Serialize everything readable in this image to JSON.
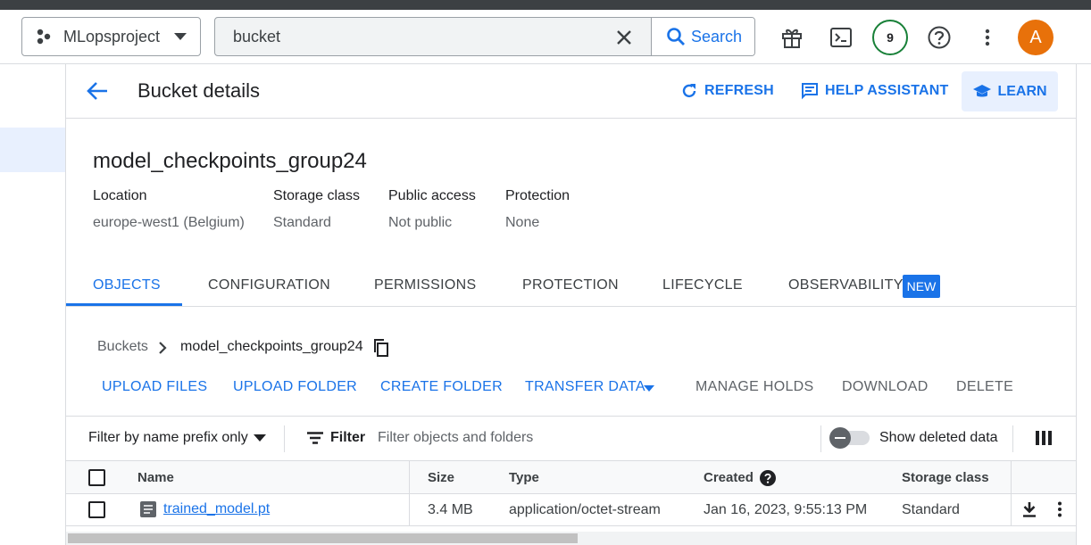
{
  "header": {
    "project_name": "MLopsproject",
    "search_value": "bucket",
    "search_button": "Search",
    "notification_count": "9",
    "avatar_initial": "A"
  },
  "page": {
    "title": "Bucket details",
    "refresh": "REFRESH",
    "help_assistant": "HELP ASSISTANT",
    "learn": "LEARN"
  },
  "bucket": {
    "name": "model_checkpoints_group24",
    "info": [
      {
        "label": "Location",
        "value": "europe-west1 (Belgium)"
      },
      {
        "label": "Storage class",
        "value": "Standard"
      },
      {
        "label": "Public access",
        "value": "Not public"
      },
      {
        "label": "Protection",
        "value": "None"
      }
    ]
  },
  "tabs": [
    {
      "label": "OBJECTS",
      "active": true
    },
    {
      "label": "CONFIGURATION"
    },
    {
      "label": "PERMISSIONS"
    },
    {
      "label": "PROTECTION"
    },
    {
      "label": "LIFECYCLE"
    },
    {
      "label": "OBSERVABILITY",
      "badge": "NEW"
    }
  ],
  "breadcrumb": {
    "root": "Buckets",
    "current": "model_checkpoints_group24"
  },
  "actions": [
    {
      "label": "UPLOAD FILES",
      "enabled": true
    },
    {
      "label": "UPLOAD FOLDER",
      "enabled": true
    },
    {
      "label": "CREATE FOLDER",
      "enabled": true
    },
    {
      "label": "TRANSFER DATA",
      "enabled": true
    },
    {
      "label": "MANAGE HOLDS",
      "enabled": false
    },
    {
      "label": "DOWNLOAD",
      "enabled": false
    },
    {
      "label": "DELETE",
      "enabled": false
    }
  ],
  "filter": {
    "prefix_mode": "Filter by name prefix only",
    "label": "Filter",
    "placeholder": "Filter objects and folders",
    "show_deleted": "Show deleted data"
  },
  "table": {
    "columns": [
      "Name",
      "Size",
      "Type",
      "Created",
      "Storage class"
    ],
    "rows": [
      {
        "name": "trained_model.pt",
        "size": "3.4 MB",
        "type": "application/octet-stream",
        "created": "Jan 16, 2023, 9:55:13 PM",
        "storage_class": "Standard"
      }
    ]
  },
  "colors": {
    "accent": "#1a73e8",
    "avatar": "#e8710a",
    "badge_ring": "#188038"
  }
}
